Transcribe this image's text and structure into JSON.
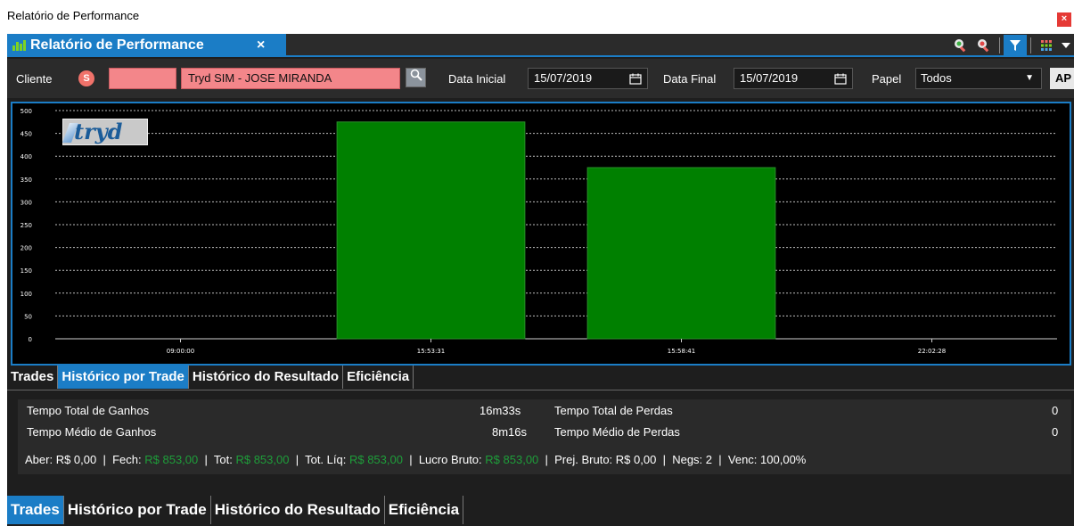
{
  "window": {
    "title": "Relatório de Performance",
    "close_label": "×"
  },
  "tab": {
    "label": "Relatório de Performance",
    "close_label": "×"
  },
  "filters": {
    "cliente_label": "Cliente",
    "s_badge": "S",
    "cliente_code": "",
    "cliente_name": "Tryd SIM - JOSE MIRANDA",
    "data_inicial_label": "Data Inicial",
    "data_inicial_value": "15/07/2019",
    "data_final_label": "Data Final",
    "data_final_value": "15/07/2019",
    "papel_label": "Papel",
    "papel_value": "Todos",
    "apply_label": "AP"
  },
  "chart_data": {
    "type": "bar",
    "categories": [
      "09:00:00",
      "15:53:31",
      "15:58:41",
      "22:02:28"
    ],
    "values": [
      0,
      475,
      375,
      0
    ],
    "ylim": [
      0,
      500
    ],
    "yticks": [
      0,
      50,
      100,
      150,
      200,
      250,
      300,
      350,
      400,
      450,
      500
    ],
    "grid": true,
    "bar_color": "#008000",
    "background": "#000000",
    "logo": "tryd"
  },
  "subtabs": {
    "items": [
      {
        "label": "Trades"
      },
      {
        "label": "Histórico por Trade"
      },
      {
        "label": "Histórico do Resultado"
      },
      {
        "label": "Eficiência"
      }
    ]
  },
  "stats": {
    "tempo_total_ganhos_label": "Tempo Total de Ganhos",
    "tempo_total_ganhos_value": "16m33s",
    "tempo_total_perdas_label": "Tempo Total de Perdas",
    "tempo_total_perdas_value": "0",
    "tempo_medio_ganhos_label": "Tempo Médio de Ganhos",
    "tempo_medio_ganhos_value": "8m16s",
    "tempo_medio_perdas_label": "Tempo Médio de Perdas",
    "tempo_medio_perdas_value": "0"
  },
  "summary": {
    "aber_label": "Aber:",
    "aber_value": "R$ 0,00",
    "fech_label": "Fech:",
    "fech_value": "R$ 853,00",
    "tot_label": "Tot:",
    "tot_value": "R$ 853,00",
    "totliq_label": "Tot. Líq:",
    "totliq_value": "R$ 853,00",
    "lucro_label": "Lucro Bruto:",
    "lucro_value": "R$ 853,00",
    "prej_label": "Prej. Bruto:",
    "prej_value": "R$ 0,00",
    "negs_label": "Negs:",
    "negs_value": "2",
    "venc_label": "Venc:",
    "venc_value": "100,00%",
    "separator": "|"
  },
  "colors": {
    "accent": "#1b7dc6",
    "positive": "#1e9e3a",
    "input_pink": "#f3868a"
  }
}
